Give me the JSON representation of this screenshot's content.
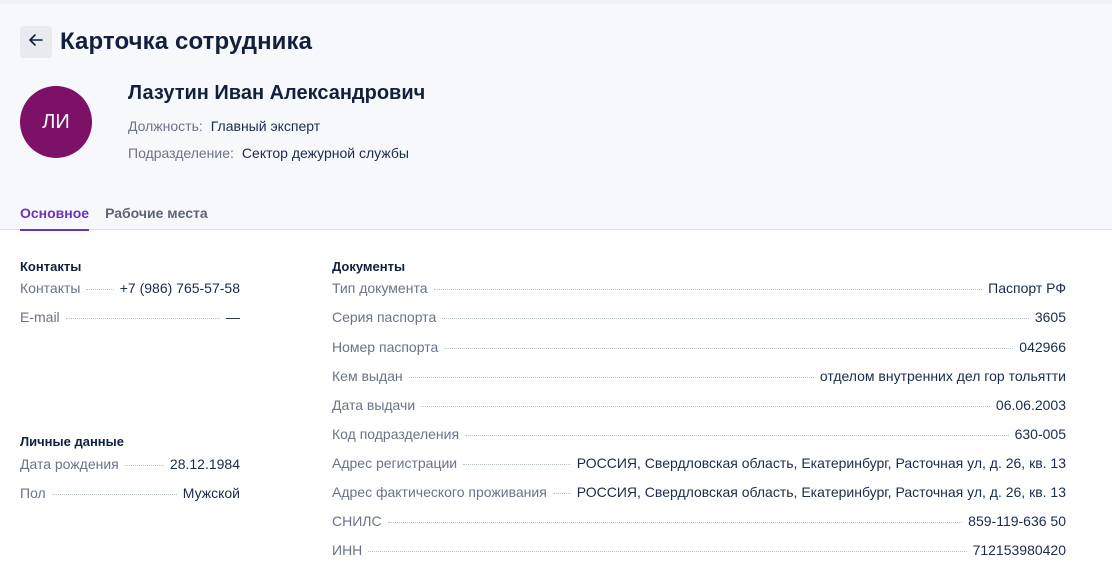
{
  "header": {
    "title": "Карточка сотрудника",
    "back_icon": "arrow-left-icon"
  },
  "employee": {
    "initials": "ЛИ",
    "avatar_color": "#7d1168",
    "full_name": "Лазутин Иван Александрович",
    "position_label": "Должность:",
    "position_value": "Главный эксперт",
    "department_label": "Подразделение:",
    "department_value": "Сектор дежурной службы"
  },
  "tabs": [
    {
      "label": "Основное",
      "active": true
    },
    {
      "label": "Рабочие места",
      "active": false
    }
  ],
  "contacts": {
    "title": "Контакты",
    "rows": [
      {
        "label": "Контакты",
        "value": "+7 (986) 765-57-58"
      },
      {
        "label": "E-mail",
        "value": "—"
      }
    ]
  },
  "personal": {
    "title": "Личные данные",
    "rows": [
      {
        "label": "Дата рождения",
        "value": "28.12.1984"
      },
      {
        "label": "Пол",
        "value": "Мужской"
      }
    ]
  },
  "documents": {
    "title": "Документы",
    "rows": [
      {
        "label": "Тип документа",
        "value": "Паспорт РФ"
      },
      {
        "label": "Серия паспорта",
        "value": "3605"
      },
      {
        "label": "Номер паспорта",
        "value": "042966"
      },
      {
        "label": "Кем выдан",
        "value": "отделом внутренних дел гор тольятти"
      },
      {
        "label": "Дата выдачи",
        "value": "06.06.2003"
      },
      {
        "label": "Код подразделения",
        "value": "630-005"
      },
      {
        "label": "Адрес регистрации",
        "value": "РОССИЯ, Свердловская область, Екатеринбург, Расточная ул, д. 26, кв. 13"
      },
      {
        "label": "Адрес фактического проживания",
        "value": "РОССИЯ, Свердловская область, Екатеринбург, Расточная ул, д. 26, кв. 13"
      },
      {
        "label": "СНИЛС",
        "value": "859-119-636 50"
      },
      {
        "label": "ИНН",
        "value": "712153980420"
      }
    ]
  },
  "colors": {
    "accent": "#6a33b8",
    "text": "#1b2b4b",
    "muted": "#6a7388"
  }
}
